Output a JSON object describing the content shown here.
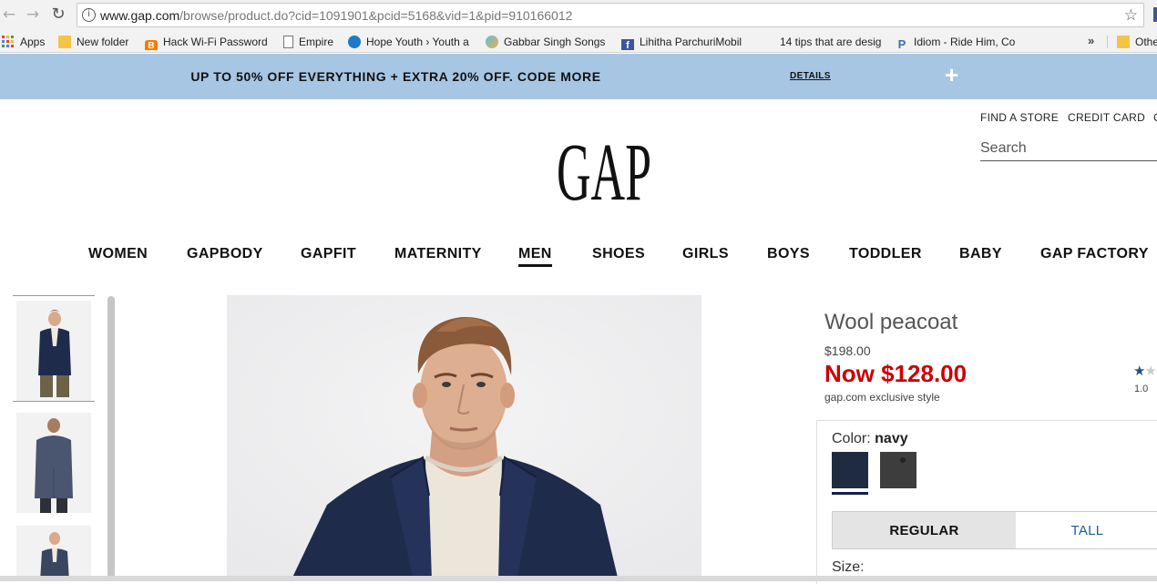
{
  "browser": {
    "url_host": "www.gap.com",
    "url_path": "/browse/product.do?cid=1091901&pcid=5168&vid=1&pid=910166012",
    "back_icon": "arrow-left-icon",
    "forward_icon": "arrow-right-icon",
    "reload_icon": "reload-icon",
    "bookmark_star_icon": "star-icon"
  },
  "bookmarks": {
    "items": [
      {
        "label": "Apps",
        "icon": "apps-grid-icon"
      },
      {
        "label": "New folder",
        "icon": "folder-icon"
      },
      {
        "label": "Hack Wi-Fi Password",
        "icon": "blogger-icon"
      },
      {
        "label": "Empire",
        "icon": "page-icon"
      },
      {
        "label": "Hope Youth › Youth a",
        "icon": "site-icon"
      },
      {
        "label": "Gabbar Singh Songs |",
        "icon": "site-icon"
      },
      {
        "label": "Lihitha ParchuriMobil",
        "icon": "facebook-icon"
      },
      {
        "label": "14 tips that are desig",
        "icon": ""
      },
      {
        "label": "Idiom - Ride Him, Co",
        "icon": "idiom-icon"
      }
    ],
    "more": "»",
    "other": "Othe"
  },
  "promo": {
    "text": "UP TO 50% OFF EVERYTHING + EXTRA 20% OFF. CODE MORE",
    "details": "DETAILS",
    "expand": "+"
  },
  "header": {
    "find_store": "FIND A STORE",
    "credit_card": "CREDIT CARD",
    "search_placeholder": "Search",
    "logo_text": "GAP"
  },
  "categories": [
    "WOMEN",
    "GAPBODY",
    "GAPFIT",
    "MATERNITY",
    "MEN",
    "SHOES",
    "GIRLS",
    "BOYS",
    "TODDLER",
    "BABY",
    "GAP FACTORY"
  ],
  "active_category": "MEN",
  "product": {
    "title": "Wool peacoat",
    "was_price": "$198.00",
    "now_price": "Now $128.00",
    "exclusive": "gap.com exclusive style",
    "rating_value": "1.0",
    "rating_stars_filled": 1,
    "rating_stars_total": 2,
    "color_label": "Color:",
    "color_value": "navy",
    "swatches": [
      {
        "name": "navy",
        "color": "#1f2b40"
      },
      {
        "name": "charcoal",
        "color": "#3d3d3d"
      }
    ],
    "fit_tabs": {
      "regular": "REGULAR",
      "tall": "TALL"
    },
    "size_label": "Size:"
  },
  "colors": {
    "promo_bg": "#a7c6e3",
    "sale_red": "#cc0000",
    "link_blue": "#1a5ea6",
    "coat_navy": "#1f2b4a"
  }
}
